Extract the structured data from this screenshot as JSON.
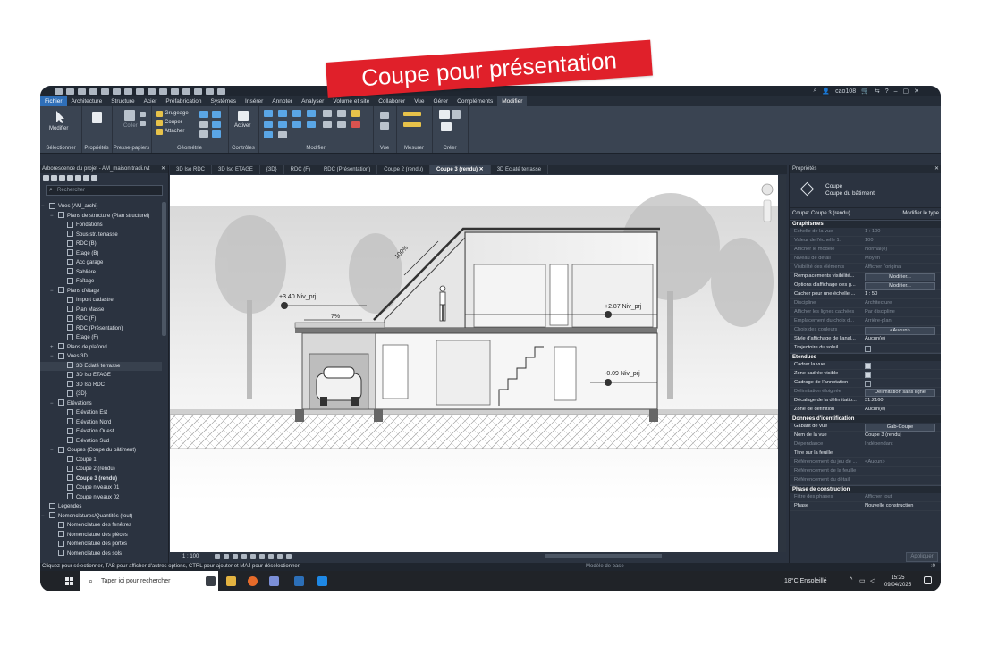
{
  "banner": "Coupe pour présentation",
  "toolbar": {
    "user": "cao108",
    "help": "?"
  },
  "ribbon_tabs": [
    "Fichier",
    "Architecture",
    "Structure",
    "Acier",
    "Préfabrication",
    "Systèmes",
    "Insérer",
    "Annoter",
    "Analyser",
    "Volume et site",
    "Collaborer",
    "Vue",
    "Gérer",
    "Compléments",
    "Modifier"
  ],
  "ribbon": {
    "modify_label": "Modifier",
    "select_label": "Sélectionner",
    "properties_label": "Propriétés",
    "clipboard_label": "Presse-papiers",
    "coller": "Coller",
    "grugeage": "Grugeage",
    "couper": "Couper",
    "attacher": "Attacher",
    "geometry_label": "Géométrie",
    "activer": "Activer",
    "controls_label": "Contrôles",
    "modifier_group": "Modifier",
    "view_label": "Vue",
    "measure_label": "Mesurer",
    "create_label": "Créer"
  },
  "browser": {
    "title": "Arborescence du projet - AM_maison tradi.rvt",
    "search_placeholder": "Rechercher",
    "tree": [
      {
        "label": "Vues (AM_archi)",
        "level": 0,
        "tog": "−"
      },
      {
        "label": "Plans de structure (Plan structurel)",
        "level": 1,
        "tog": "−"
      },
      {
        "label": "Fondations",
        "level": 2
      },
      {
        "label": "Sous str. terrasse",
        "level": 2
      },
      {
        "label": "RDC (B)",
        "level": 2
      },
      {
        "label": "Etage (B)",
        "level": 2
      },
      {
        "label": "Acc garage",
        "level": 2
      },
      {
        "label": "Sablière",
        "level": 2
      },
      {
        "label": "Faîtage",
        "level": 2
      },
      {
        "label": "Plans d'étage",
        "level": 1,
        "tog": "−"
      },
      {
        "label": "Import cadastre",
        "level": 2
      },
      {
        "label": "Plan Masse",
        "level": 2
      },
      {
        "label": "RDC (F)",
        "level": 2
      },
      {
        "label": "RDC (Présentation)",
        "level": 2
      },
      {
        "label": "Etage (F)",
        "level": 2
      },
      {
        "label": "Plans de plafond",
        "level": 1,
        "tog": "+"
      },
      {
        "label": "Vues 3D",
        "level": 1,
        "tog": "−"
      },
      {
        "label": "3D Eclaté terrasse",
        "level": 2,
        "sel": true
      },
      {
        "label": "3D Iso ETAGE",
        "level": 2
      },
      {
        "label": "3D Iso RDC",
        "level": 2
      },
      {
        "label": "{3D}",
        "level": 2
      },
      {
        "label": "Elévations",
        "level": 1,
        "tog": "−"
      },
      {
        "label": "Elévation Est",
        "level": 2
      },
      {
        "label": "Elévation Nord",
        "level": 2
      },
      {
        "label": "Elévation Ouest",
        "level": 2
      },
      {
        "label": "Elévation Sud",
        "level": 2
      },
      {
        "label": "Coupes (Coupe du bâtiment)",
        "level": 1,
        "tog": "−"
      },
      {
        "label": "Coupe 1",
        "level": 2
      },
      {
        "label": "Coupe 2 (rendu)",
        "level": 2
      },
      {
        "label": "Coupe 3 (rendu)",
        "level": 2,
        "bold": true
      },
      {
        "label": "Coupe niveaux 01",
        "level": 2
      },
      {
        "label": "Coupe niveaux 02",
        "level": 2
      },
      {
        "label": "Légendes",
        "level": 0
      },
      {
        "label": "Nomenclatures/Quantités (tout)",
        "level": 0,
        "tog": "−"
      },
      {
        "label": "Nomenclature des fenêtres",
        "level": 1
      },
      {
        "label": "Nomenclature des pièces",
        "level": 1
      },
      {
        "label": "Nomenclature des portes",
        "level": 1
      },
      {
        "label": "Nomenclature des sols",
        "level": 1
      }
    ]
  },
  "view_tabs": [
    {
      "label": "3D Iso RDC"
    },
    {
      "label": "3D Iso ETAGE"
    },
    {
      "label": "{3D}"
    },
    {
      "label": "RDC (F)"
    },
    {
      "label": "RDC (Présentation)"
    },
    {
      "label": "Coupe 2 (rendu)"
    },
    {
      "label": "Coupe 3 (rendu)",
      "active": true
    },
    {
      "label": "3D Eclaté terrasse"
    }
  ],
  "drawing": {
    "level_1": "+3.40  Niv_prj",
    "level_2": "+2.87  Niv_prj",
    "level_3": "-0.09  Niv_prj",
    "roof_slope": "100%",
    "terrace_slope": "7%"
  },
  "viewbar": {
    "scale": "1 : 100"
  },
  "status": {
    "message": "Cliquez pour sélectionner, TAB pour afficher d'autres options, CTRL pour ajouter et MAJ pour désélectionner.",
    "model": "Modèle de base",
    "zero": ":0"
  },
  "properties": {
    "title": "Propriétés",
    "type_line1": "Coupe",
    "type_line2": "Coupe du bâtiment",
    "selector": "Coupe: Coupe 3 (rendu)",
    "edit_type": "Modifier le type",
    "apply": "Appliquer",
    "sections": [
      {
        "name": "Graphismes",
        "rows": [
          {
            "k": "Echelle de la vue",
            "v": "1 : 100",
            "dis": true
          },
          {
            "k": "Valeur de l'échelle    1:",
            "v": "100",
            "dis": true
          },
          {
            "k": "Afficher le modèle",
            "v": "Normal(e)",
            "dis": true
          },
          {
            "k": "Niveau de détail",
            "v": "Moyen",
            "dis": true
          },
          {
            "k": "Visibilité des éléments",
            "v": "Afficher l'original",
            "dis": true
          },
          {
            "k": "Remplacements visibilité...",
            "v": "Modifier...",
            "btn": true
          },
          {
            "k": "Options d'affichage des g...",
            "v": "Modifier...",
            "btn": true
          },
          {
            "k": "Cacher pour une échelle ...",
            "v": "1 : 50"
          },
          {
            "k": "Discipline",
            "v": "Architecture",
            "dis": true
          },
          {
            "k": "Afficher les lignes cachées",
            "v": "Par discipline",
            "dis": true
          },
          {
            "k": "Emplacement du choix d...",
            "v": "Arrière-plan",
            "dis": true
          },
          {
            "k": "Choix des couleurs",
            "v": "<Aucun>",
            "btn": true,
            "dis": true
          },
          {
            "k": "Style d'affichage de l'anal...",
            "v": "Aucun(e)"
          },
          {
            "k": "Trajectoire du soleil",
            "chk": false
          }
        ]
      },
      {
        "name": "Etendues",
        "rows": [
          {
            "k": "Cadrer la vue",
            "chk": true
          },
          {
            "k": "Zone cadrée visible",
            "chk": true
          },
          {
            "k": "Cadrage de l'annotation",
            "chk": false
          },
          {
            "k": "Délimitation éloignée",
            "v": "Délimitation sans ligne",
            "btn": true,
            "dis": true
          },
          {
            "k": "Décalage de la délimitatio...",
            "v": "31.2160"
          },
          {
            "k": "Zone de définition",
            "v": "Aucun(e)"
          }
        ]
      },
      {
        "name": "Données d'identification",
        "rows": [
          {
            "k": "Gabarit de vue",
            "v": "Gab-Coupe",
            "btn": true
          },
          {
            "k": "Nom de la vue",
            "v": "Coupe 3 (rendu)"
          },
          {
            "k": "Dépendance",
            "v": "Indépendant",
            "dis": true
          },
          {
            "k": "Titre sur la feuille",
            "v": ""
          },
          {
            "k": "Référencement du jeu de ...",
            "v": "<Aucun>",
            "dis": true
          },
          {
            "k": "Référencement de la feuille",
            "v": "",
            "dis": true
          },
          {
            "k": "Référencement du détail",
            "v": "",
            "dis": true
          }
        ]
      },
      {
        "name": "Phase de construction",
        "rows": [
          {
            "k": "Filtre des phases",
            "v": "Afficher tout",
            "dis": true
          },
          {
            "k": "Phase",
            "v": "Nouvelle construction"
          }
        ]
      }
    ]
  },
  "taskbar": {
    "search": "Taper ici pour rechercher",
    "weather": "18°C  Ensoleillé",
    "time": "15:25",
    "date": "09/04/2025"
  }
}
